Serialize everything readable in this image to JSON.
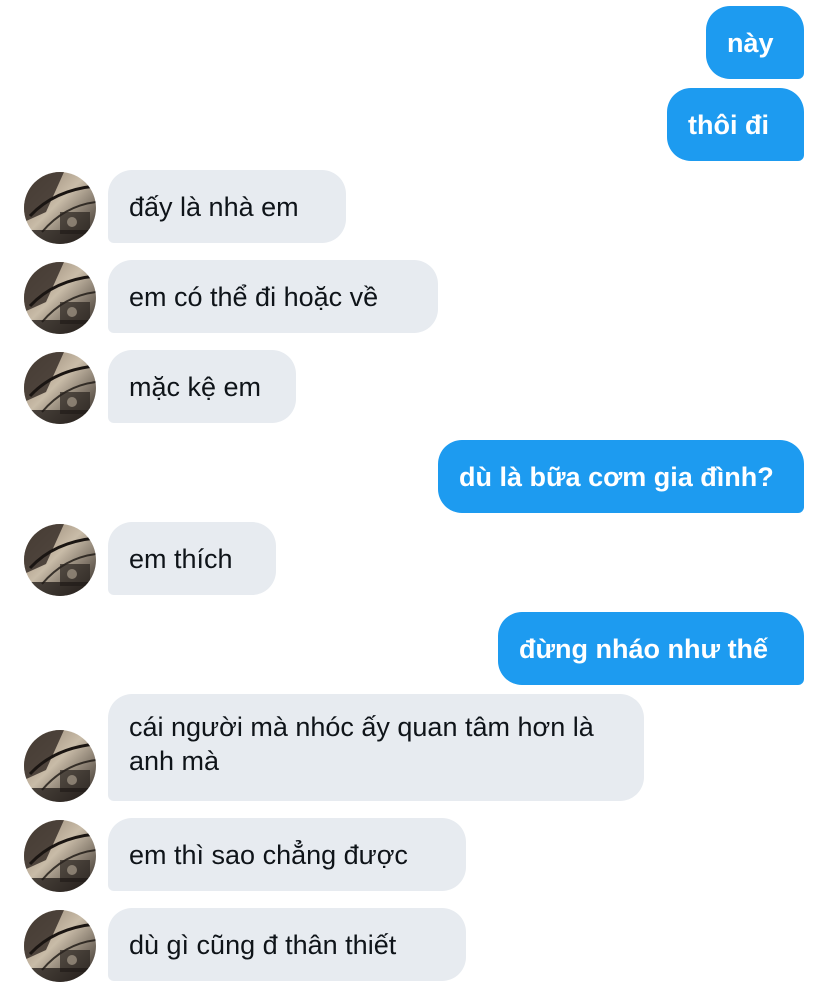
{
  "messages": [
    {
      "direction": "sent",
      "text": "này"
    },
    {
      "direction": "sent",
      "text": "thôi đi"
    },
    {
      "direction": "received",
      "text": "đấy là nhà em"
    },
    {
      "direction": "received",
      "text": "em có thể đi hoặc về"
    },
    {
      "direction": "received",
      "text": "mặc kệ em"
    },
    {
      "direction": "sent",
      "text": "dù là bữa cơm gia đình?"
    },
    {
      "direction": "received",
      "text": "em thích"
    },
    {
      "direction": "sent",
      "text": "đừng nháo như thế"
    },
    {
      "direction": "received",
      "text": "cái người mà nhóc ấy quan tâm hơn là anh mà"
    },
    {
      "direction": "received",
      "text": "em thì sao chẳng được"
    },
    {
      "direction": "received",
      "text": "dù gì cũng đ thân thiết"
    }
  ],
  "colors": {
    "sent_bubble": "#1d9bf0",
    "received_bubble": "#e7ebf0",
    "sent_text": "#ffffff",
    "received_text": "#0f1419"
  },
  "icons": {
    "avatar": "contact-avatar-photo"
  }
}
